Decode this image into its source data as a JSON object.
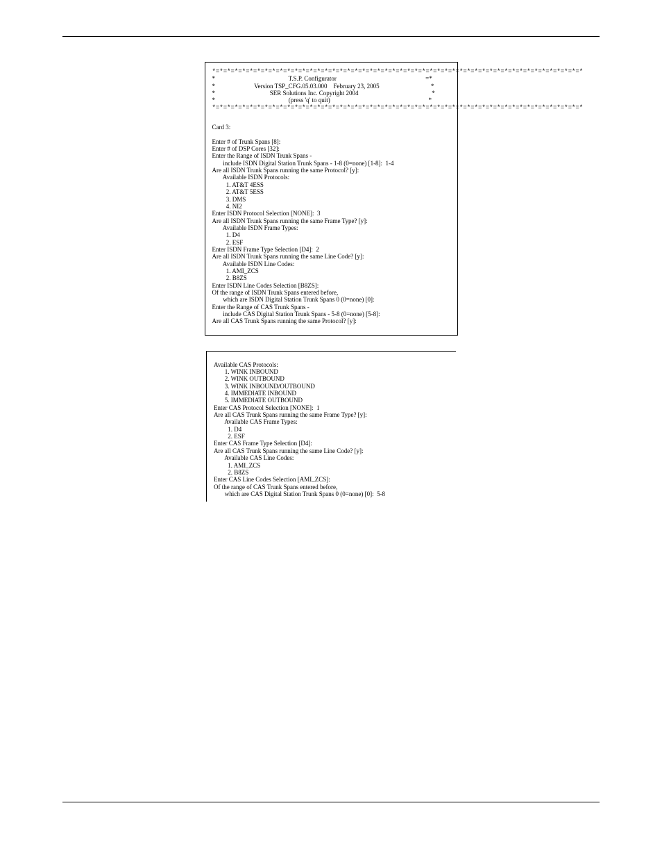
{
  "box1": {
    "starline": "*=*=*=*=*=*=*=*=*=*=*=*=*=*=*=*=*=*=*=*=*=*=*=*=*=*=*=*=*=*=*=*=*=*=*=*=*=*=*=*=*=*=*=*=*=*=*=*=*=*",
    "banner_l1": "*                                               T.S.P. Configurator                                                         =*",
    "banner_l2": "*                         Version TSP_CFG.05.03.000    February 23, 2005                                 *",
    "banner_l3": "*                                   SER Solutions Inc. Copyright 2004                                               *",
    "banner_l4": "*                                               (press 'q' to quit)                                                               *",
    "body": "Card 3:\n\nEnter # of Trunk Spans [8]:\nEnter # of DSP Cores [32]:\nEnter the Range of ISDN Trunk Spans -\n       include ISDN Digital Station Trunk Spans - 1-8 (0=none) [1-8]:  1-4\nAre all ISDN Trunk Spans running the same Protocol? [y]:\n       Available ISDN Protocols:\n         1. AT&T 4ESS\n         2. AT&T 5ESS\n         3. DMS\n         4. NI2\nEnter ISDN Protocol Selection [NONE]:  3\nAre all ISDN Trunk Spans running the same Frame Type? [y]:\n       Available ISDN Frame Types:\n         1. D4\n         2. ESF\nEnter ISDN Frame Type Selection [D4]:  2\nAre all ISDN Trunk Spans running the same Line Code? [y]:\n       Available ISDN Line Codes:\n         1. AMI_ZCS\n         2. B8ZS\nEnter ISDN Line Codes Selection [B8ZS]:\nOf the range of ISDN Trunk Spans entered before,\n       which are ISDN Digital Station Trunk Spans 0 (0=none) [0]:\nEnter the Range of CAS Trunk Spans -\n       include CAS Digital Station Trunk Spans - 5-8 (0=none) [5-8]:\nAre all CAS Trunk Spans running the same Protocol? [y]:"
  },
  "box2": {
    "body": "Available CAS Protocols:\n       1. WINK INBOUND\n       2. WINK OUTBOUND\n       3. WINK INBOUND/OUTBOUND\n       4. IMMEDIATE INBOUND\n       5. IMMEDIATE OUTBOUND\nEnter CAS Protocol Selection [NONE]:  1\nAre all CAS Trunk Spans running the same Frame Type? [y]:\n       Available CAS Frame Types:\n         1. D4\n         2. ESF\nEnter CAS Frame Type Selection [D4]:\nAre all CAS Trunk Spans running the same Line Code? [y]:\n       Available CAS Line Codes:\n         1. AMI_ZCS\n         2. B8ZS\nEnter CAS Line Codes Selection [AMI_ZCS]:\nOf the range of CAS Trunk Spans entered before,\n       which are CAS Digital Station Trunk Spans 0 (0=none) [0]:  5-8"
  }
}
